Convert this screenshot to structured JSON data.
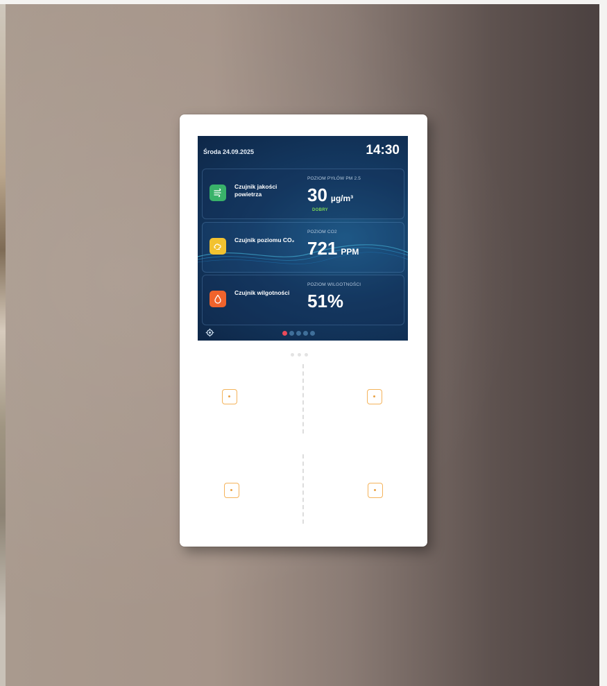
{
  "screen": {
    "date": "Środa 24.09.2025",
    "time": "14:30",
    "cards": [
      {
        "sensor_name": "Czujnik jakości powietrza",
        "metric_label": "POZIOM PYŁÓW PM 2.5",
        "value": "30",
        "unit": "µg/m³",
        "status": "DOBRY",
        "icon": "air-quality-icon",
        "color": "#39b26a"
      },
      {
        "sensor_name": "Czujnik poziomu CO₂",
        "metric_label": "POZIOM CO2",
        "value": "721",
        "unit": "PPM",
        "icon": "co2-icon",
        "color": "#f2c230"
      },
      {
        "sensor_name": "Czujnik wilgotności",
        "metric_label": "POZIOM WILGOTNOŚCI",
        "value": "51%",
        "unit": "",
        "icon": "humidity-drop-icon",
        "color": "#f0632c"
      }
    ],
    "settings_icon": "gear-icon",
    "page_indicator": {
      "pages": 5,
      "active": 1,
      "active_color": "#ea4a5a"
    }
  },
  "hardware": {
    "touch_buttons": [
      "touch-button-top-left",
      "touch-button-top-right",
      "touch-button-bottom-left",
      "touch-button-bottom-right"
    ],
    "accent_color": "#f4b35a"
  }
}
